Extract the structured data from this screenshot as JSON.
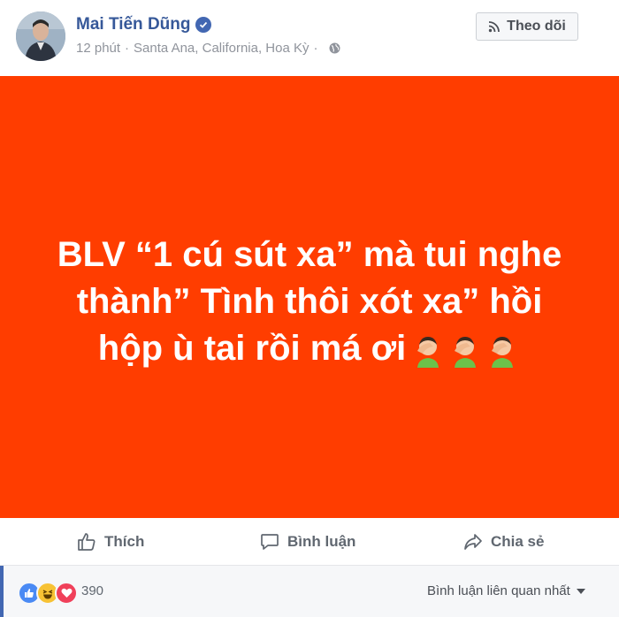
{
  "author": {
    "name": "Mai Tiến Dũng",
    "verified_icon": "verified-badge-icon"
  },
  "meta": {
    "time": "12 phút",
    "separator": "·",
    "location": "Santa Ana, California, Hoa Kỳ",
    "privacy_icon": "globe-icon"
  },
  "follow_button": {
    "label": "Theo dõi",
    "icon": "rss-icon"
  },
  "content": {
    "background_color": "#ff3d00",
    "lines": [
      "BLV “1 cú sút xa” mà tui nghe",
      "thành” Tình thôi xót xa” hồi",
      "hộp ù tai rồi má ơi"
    ],
    "emojis": [
      "facepalm-emoji",
      "facepalm-emoji",
      "facepalm-emoji"
    ]
  },
  "actions": {
    "like": "Thích",
    "comment": "Bình luận",
    "share": "Chia sẻ"
  },
  "reactions": {
    "icons": [
      "like-reaction-icon",
      "haha-reaction-icon",
      "love-reaction-icon"
    ],
    "count": "390",
    "sort_label": "Bình luận liên quan nhất"
  },
  "colors": {
    "accent": "#4267b2",
    "name": "#365899",
    "meta": "#90949c"
  }
}
